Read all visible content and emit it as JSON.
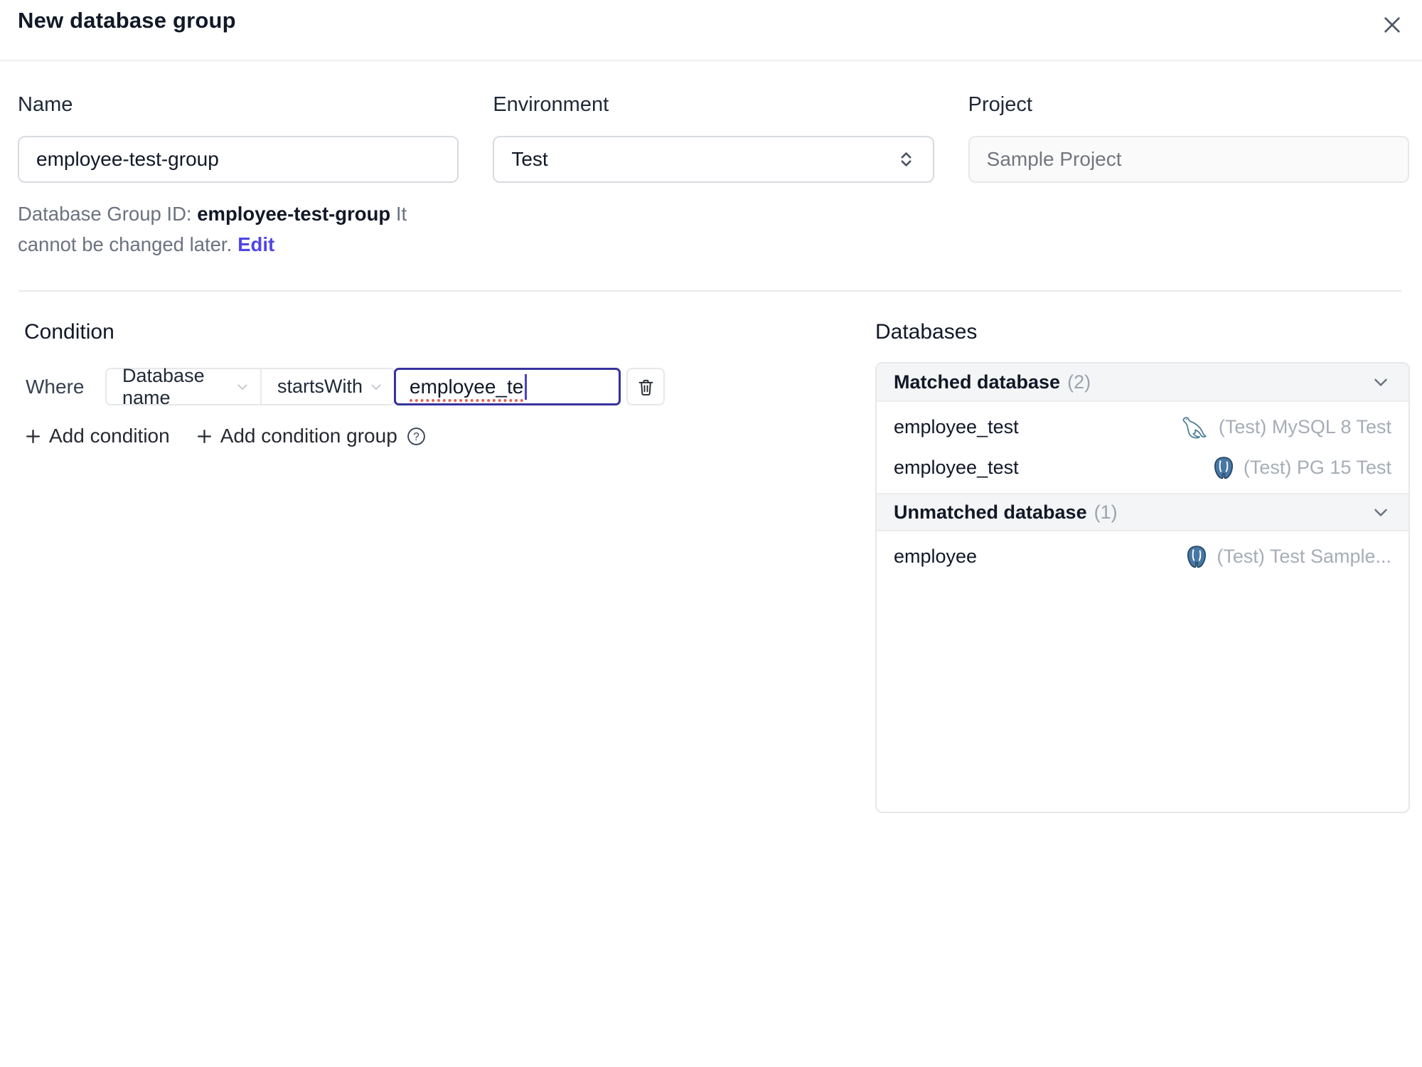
{
  "dialog": {
    "title": "New database group"
  },
  "form": {
    "name": {
      "label": "Name",
      "value": "employee-test-group"
    },
    "environment": {
      "label": "Environment",
      "value": "Test"
    },
    "project": {
      "label": "Project",
      "value": "Sample Project"
    },
    "group_id_note": {
      "prefix": "Database Group ID: ",
      "id": "employee-test-group",
      "suffix": " It cannot be changed later.",
      "edit_label": "Edit"
    }
  },
  "condition": {
    "heading": "Condition",
    "where_label": "Where",
    "field": "Database name",
    "operator": "startsWith",
    "value": "employee_te",
    "add_condition_label": "Add condition",
    "add_condition_group_label": "Add condition group"
  },
  "databases": {
    "heading": "Databases",
    "matched": {
      "title": "Matched database",
      "count": "(2)",
      "rows": [
        {
          "name": "employee_test",
          "engine": "mysql",
          "instance": "(Test) MySQL 8 Test"
        },
        {
          "name": "employee_test",
          "engine": "postgres",
          "instance": "(Test) PG 15 Test"
        }
      ]
    },
    "unmatched": {
      "title": "Unmatched database",
      "count": "(1)",
      "rows": [
        {
          "name": "employee",
          "engine": "postgres",
          "instance": "(Test) Test Sample..."
        }
      ]
    }
  },
  "icons": {
    "close": "x-mark",
    "environment_select": "chevron-up-down",
    "field_dropdown": "chevron-down",
    "operator_dropdown": "chevron-down",
    "delete_condition": "trash",
    "add": "plus",
    "help": "question-mark-circle",
    "section_collapse": "chevron-down",
    "engine_mysql": "mysql-dolphin",
    "engine_postgres": "postgres-elephant"
  },
  "colors": {
    "accent_link": "#4f46e5",
    "focus_border": "#37329e",
    "spellcheck_underline": "#e2614f",
    "postgres_blue": "#4877a3",
    "mysql_teal": "#4c7d93",
    "section_header_bg": "#f4f5f6",
    "border": "#e7e8ea",
    "muted_text": "#9ca3af"
  }
}
